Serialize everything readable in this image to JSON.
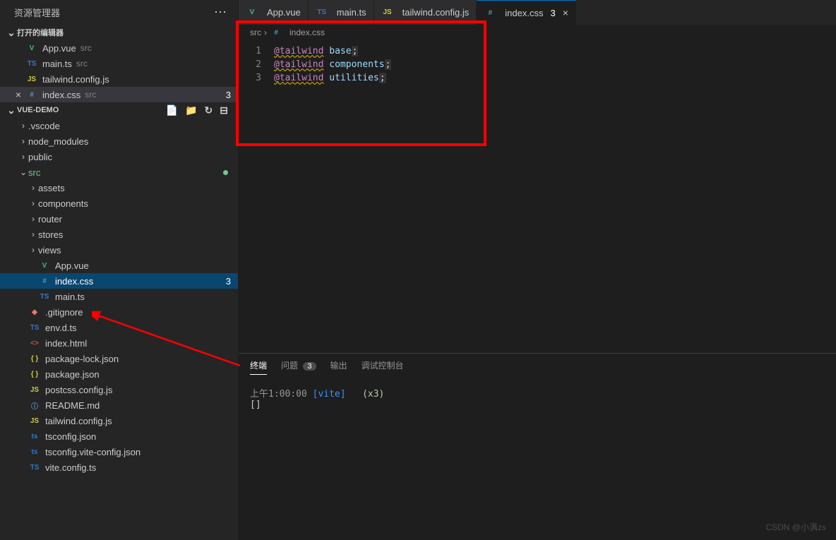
{
  "sidebar": {
    "title": "资源管理器",
    "openEditorsLabel": "打开的编辑器",
    "editors": [
      {
        "icon": "vue",
        "iconText": "V",
        "name": "App.vue",
        "path": "src"
      },
      {
        "icon": "ts",
        "iconText": "TS",
        "name": "main.ts",
        "path": "src"
      },
      {
        "icon": "js",
        "iconText": "JS",
        "name": "tailwind.config.js",
        "path": ""
      },
      {
        "icon": "css",
        "iconText": "#",
        "name": "index.css",
        "path": "src",
        "active": true,
        "badge": "3"
      }
    ],
    "projectName": "VUE-DEMO",
    "tree": [
      {
        "type": "folder",
        "name": ".vscode",
        "indent": 1,
        "chev": "›"
      },
      {
        "type": "folder",
        "name": "node_modules",
        "indent": 1,
        "chev": "›"
      },
      {
        "type": "folder",
        "name": "public",
        "indent": 1,
        "chev": "›"
      },
      {
        "type": "folder",
        "name": "src",
        "indent": 1,
        "chev": "⌄",
        "gitNew": true,
        "modified": true
      },
      {
        "type": "folder",
        "name": "assets",
        "indent": 2,
        "chev": "›"
      },
      {
        "type": "folder",
        "name": "components",
        "indent": 2,
        "chev": "›"
      },
      {
        "type": "folder",
        "name": "router",
        "indent": 2,
        "chev": "›"
      },
      {
        "type": "folder",
        "name": "stores",
        "indent": 2,
        "chev": "›"
      },
      {
        "type": "folder",
        "name": "views",
        "indent": 2,
        "chev": "›"
      },
      {
        "type": "file",
        "name": "App.vue",
        "indent": 2,
        "icon": "vue",
        "iconText": "V"
      },
      {
        "type": "file",
        "name": "index.css",
        "indent": 2,
        "icon": "css",
        "iconText": "#",
        "selected": true,
        "badge": "3"
      },
      {
        "type": "file",
        "name": "main.ts",
        "indent": 2,
        "icon": "ts",
        "iconText": "TS"
      },
      {
        "type": "file",
        "name": ".gitignore",
        "indent": 1,
        "icon": "gitignore",
        "iconText": "◆"
      },
      {
        "type": "file",
        "name": "env.d.ts",
        "indent": 1,
        "icon": "ts",
        "iconText": "TS"
      },
      {
        "type": "file",
        "name": "index.html",
        "indent": 1,
        "icon": "html",
        "iconText": "<>"
      },
      {
        "type": "file",
        "name": "package-lock.json",
        "indent": 1,
        "icon": "json",
        "iconText": "{ }"
      },
      {
        "type": "file",
        "name": "package.json",
        "indent": 1,
        "icon": "json",
        "iconText": "{ }"
      },
      {
        "type": "file",
        "name": "postcss.config.js",
        "indent": 1,
        "icon": "js",
        "iconText": "JS"
      },
      {
        "type": "file",
        "name": "README.md",
        "indent": 1,
        "icon": "info",
        "iconText": "ⓘ"
      },
      {
        "type": "file",
        "name": "tailwind.config.js",
        "indent": 1,
        "icon": "js",
        "iconText": "JS"
      },
      {
        "type": "file",
        "name": "tsconfig.json",
        "indent": 1,
        "icon": "ts",
        "iconText": "ts"
      },
      {
        "type": "file",
        "name": "tsconfig.vite-config.json",
        "indent": 1,
        "icon": "ts",
        "iconText": "ts"
      },
      {
        "type": "file",
        "name": "vite.config.ts",
        "indent": 1,
        "icon": "ts",
        "iconText": "TS"
      }
    ]
  },
  "tabs": [
    {
      "icon": "vue",
      "iconText": "V",
      "label": "App.vue"
    },
    {
      "icon": "ts",
      "iconText": "TS",
      "label": "main.ts"
    },
    {
      "icon": "js",
      "iconText": "JS",
      "label": "tailwind.config.js"
    },
    {
      "icon": "css",
      "iconText": "#",
      "label": "index.css",
      "badge": "3",
      "active": true,
      "close": true
    }
  ],
  "breadcrumb": {
    "folder": "src",
    "icon": "#",
    "file": "index.css"
  },
  "code": {
    "lines": [
      {
        "n": "1",
        "at": "@tailwind",
        "ident": "base",
        "punct": ";"
      },
      {
        "n": "2",
        "at": "@tailwind",
        "ident": "components",
        "punct": ";"
      },
      {
        "n": "3",
        "at": "@tailwind",
        "ident": "utilities",
        "punct": ";"
      }
    ]
  },
  "terminal": {
    "tabs": {
      "terminal": "终端",
      "problems": "问题",
      "problemsBadge": "3",
      "output": "输出",
      "debug": "调试控制台"
    },
    "time": "上午1:00:00",
    "vite": "[vite]",
    "x3": "(x3)",
    "bracket": "[]"
  },
  "watermark": "CSDN @小满zs"
}
